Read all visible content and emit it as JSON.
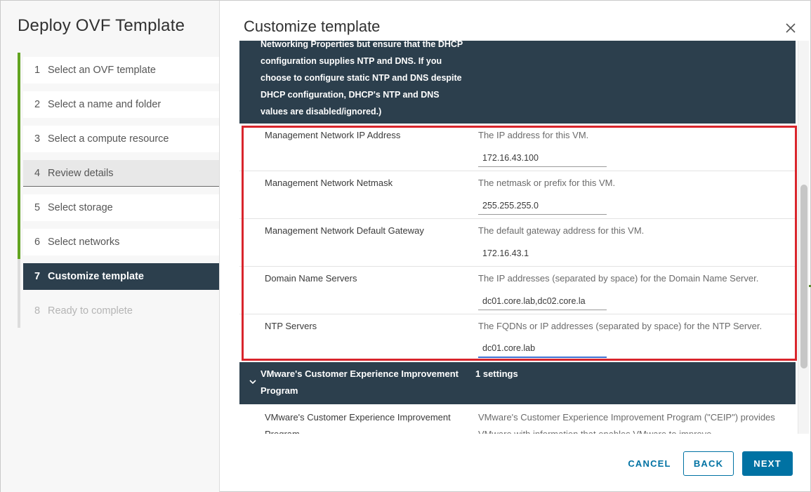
{
  "dialog": {
    "title": "Deploy OVF Template",
    "main_title": "Customize template"
  },
  "steps": [
    {
      "num": "1",
      "label": "Select an OVF template"
    },
    {
      "num": "2",
      "label": "Select a name and folder"
    },
    {
      "num": "3",
      "label": "Select a compute resource"
    },
    {
      "num": "4",
      "label": "Review details"
    },
    {
      "num": "5",
      "label": "Select storage"
    },
    {
      "num": "6",
      "label": "Select networks"
    },
    {
      "num": "7",
      "label": "Customize template"
    },
    {
      "num": "8",
      "label": "Ready to complete"
    }
  ],
  "info_block": {
    "lines": [
      "Networking Properties but ensure that the DHCP",
      "configuration supplies NTP and DNS. If you",
      "choose to configure static NTP and DNS despite",
      "DHCP configuration, DHCP's NTP and DNS",
      "values are disabled/ignored.)"
    ]
  },
  "properties": [
    {
      "label": "Management Network IP Address",
      "desc": "The IP address for this VM.",
      "value": "172.16.43.100"
    },
    {
      "label": "Management Network Netmask",
      "desc": "The netmask or prefix for this VM.",
      "value": "255.255.255.0"
    },
    {
      "label": "Management Network Default Gateway",
      "desc": "The default gateway address for this VM.",
      "value": "172.16.43.1"
    },
    {
      "label": "Domain Name Servers",
      "desc": "The IP addresses (separated by space) for the Domain Name Server.",
      "value": "dc01.core.lab,dc02.core.la"
    },
    {
      "label": "NTP Servers",
      "desc": "The FQDNs or IP addresses (separated by space) for the NTP Server.",
      "value": "dc01.core.lab"
    }
  ],
  "ceip": {
    "title": "VMware's Customer Experience Improvement Program",
    "count": "1 settings",
    "row_label": "VMware's Customer Experience Improvement Program",
    "row_desc": "VMware's Customer Experience Improvement Program (\"CEIP\") provides VMware with information that enables VMware to improve"
  },
  "footer": {
    "cancel": "CANCEL",
    "back": "BACK",
    "next": "NEXT"
  },
  "colors": {
    "accent": "#0072a3",
    "header_dark": "#2c3f4d",
    "step_complete": "#62a420",
    "highlight_box": "#d9252c"
  },
  "icons": {
    "close": "close-icon",
    "chevron": "chevron-down-icon"
  }
}
